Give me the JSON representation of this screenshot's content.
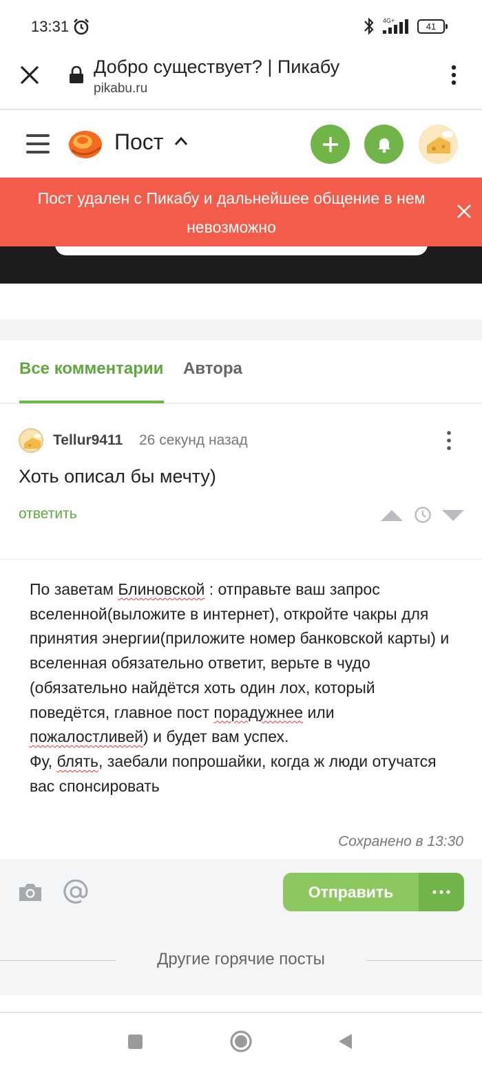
{
  "status_bar": {
    "time": "13:31",
    "network": "4G+",
    "battery": "41"
  },
  "browser": {
    "title": "Добро существует? | Пикабу",
    "url": "pikabu.ru"
  },
  "site_header": {
    "title": "Пост"
  },
  "alert": {
    "text": "Пост удален с Пикабу и дальнейшее общение в нем невозможно"
  },
  "tabs": [
    {
      "label": "Все комментарии",
      "active": true
    },
    {
      "label": "Автора",
      "active": false
    }
  ],
  "comment": {
    "user": "Tellur9411",
    "time": "26 секунд назад",
    "text": "Хоть описал бы мечту)",
    "reply_label": "ответить"
  },
  "draft": {
    "p1": "По заветам ",
    "w1": "Блиновской",
    "p2": " : отправьте ваш запрос вселенной(выложите в интернет), откройте чакры для принятия энергии(приложите номер банковской карты) и вселенная обязательно ответит, верьте в чудо (обязательно найдётся хоть один лох, который поведётся, главное пост ",
    "w2": "порадужнее",
    "p3": " или ",
    "w3": "пожалостливей",
    "p4": ") и будет вам успех.",
    "p5": "Фу, ",
    "w4": "блять",
    "p6": ", заебали попрошайки, когда ж люди отучатся вас спонсировать",
    "saved": "Сохранено в 13:30"
  },
  "composer": {
    "send_label": "Отправить"
  },
  "hot_posts": {
    "label": "Другие горячие посты"
  },
  "colors": {
    "accent_green": "#71b54a",
    "alert_red": "#f35c4a"
  },
  "icons": [
    "alarm-icon",
    "bluetooth-icon",
    "signal-icon",
    "close-icon",
    "lock-icon",
    "menu-dots-icon",
    "hamburger-icon",
    "pikabu-logo-icon",
    "chevron-up-icon",
    "plus-icon",
    "bell-icon",
    "clock-icon",
    "camera-icon",
    "at-icon"
  ]
}
